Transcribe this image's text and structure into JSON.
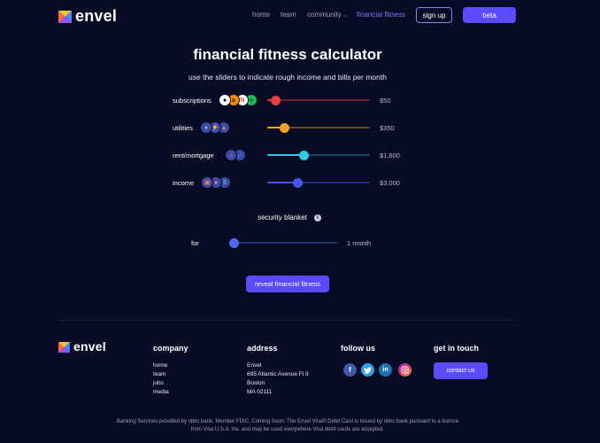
{
  "header": {
    "brand": "envel",
    "nav": [
      "home",
      "team",
      "community",
      "financial fitness"
    ],
    "signup_label": "sign up",
    "beta_label": "beta"
  },
  "page": {
    "title": "financial fitness calculator",
    "subtitle": "use the sliders to indicate rough income and bills per month"
  },
  "sliders": [
    {
      "label": "subscriptions",
      "value_text": "$50",
      "fraction": 0.08,
      "color": "#e84040",
      "track_color": "#6e1d2a",
      "icons": [
        "apple-icon",
        "amazon-icon",
        "netflix-icon",
        "spotify-icon"
      ]
    },
    {
      "label": "utilities",
      "value_text": "$350",
      "fraction": 0.16,
      "color": "#f5a524",
      "track_color": "#6a4612",
      "icons": [
        "water-drop-icon",
        "lightning-icon",
        "flame-icon"
      ]
    },
    {
      "label": "rent/mortgage",
      "value_text": "$1,800",
      "fraction": 0.35,
      "color": "#2ec9e6",
      "track_color": "#124a5c",
      "icons": [
        "house-icon",
        "home-icon"
      ]
    },
    {
      "label": "income",
      "value_text": "$3,000",
      "fraction": 0.29,
      "color": "#4654e8",
      "track_color": "#24287a",
      "icons": [
        "briefcase-icon",
        "people-icon",
        "money-bag-icon"
      ]
    }
  ],
  "security_blanket": {
    "label": "security blanket",
    "for_label": "for",
    "value_text": "1 month",
    "fraction": 0.0,
    "color": "#4e6cf0",
    "track_color": "#25306b"
  },
  "reveal_label": "reveal financial fitness",
  "footer": {
    "brand": "envel",
    "company": {
      "heading": "company",
      "links": [
        "home",
        "team",
        "jobs",
        "media"
      ]
    },
    "address": {
      "heading": "address",
      "lines": [
        "Envel",
        "695 Atlantic Avenue Fl 9",
        "Boston",
        "MA 02111"
      ]
    },
    "follow": {
      "heading": "follow us",
      "icons": [
        "facebook-icon",
        "twitter-icon",
        "linkedin-icon",
        "instagram-icon"
      ]
    },
    "contact": {
      "heading": "get in touch",
      "button_label": "contact us"
    },
    "legal": "Banking Services provided by nbkc bank, Member FDIC. Coming Soon: The Envel Visa® Debit Card is issued by nbkc bank pursuant to a license from Visa U.S.A. Inc. and may be used everywhere Visa debit cards are accepted."
  },
  "colors": {
    "background": "#070b24",
    "accent": "#5b4bff"
  }
}
